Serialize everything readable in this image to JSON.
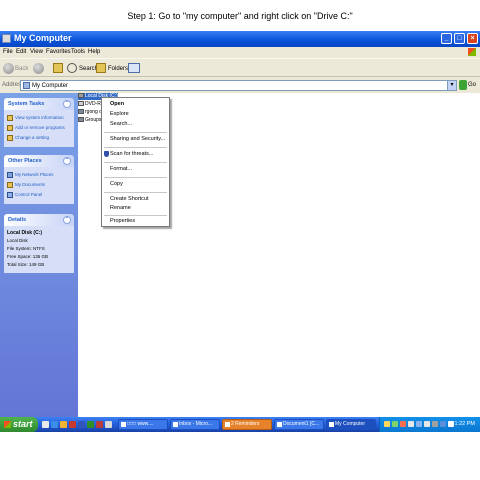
{
  "caption": "Step 1: Go to \"my computer\" and right click on \"Drive C:\"",
  "window": {
    "title": "My Computer",
    "controls": {
      "minimize": "_",
      "maximize": "□",
      "close": "×"
    }
  },
  "menubar": [
    "File",
    "Edit",
    "View",
    "Favorites",
    "Tools",
    "Help"
  ],
  "toolbar": {
    "back": "Back",
    "search": "Search",
    "folders": "Folders"
  },
  "address": {
    "label": "Address",
    "value": "My Computer",
    "go": "Go"
  },
  "sidebar": {
    "system_tasks": {
      "title": "System Tasks",
      "items": [
        "View system information",
        "Add or remove programs",
        "Change a setting"
      ]
    },
    "other_places": {
      "title": "Other Places",
      "items": [
        "My Network Places",
        "My Documents",
        "Control Panel"
      ]
    },
    "details": {
      "title": "Details",
      "name": "Local Disk (C:)",
      "type": "Local Disk",
      "file_system": "File System: NTFS",
      "free_space": "Free Space: 135 GB",
      "total_size": "Total Size: 149 GB"
    }
  },
  "content": {
    "drives": [
      "Local Disk (C:)",
      "DVD-RA",
      "rgong o",
      "Groups"
    ]
  },
  "context_menu": {
    "open": "Open",
    "explore": "Explore",
    "search": "Search...",
    "sharing": "Sharing and Security...",
    "scan": "Scan for threats...",
    "format": "Format...",
    "copy": "Copy",
    "create_shortcut": "Create Shortcut",
    "rename": "Rename",
    "properties": "Properties"
  },
  "taskbar": {
    "start": "start",
    "tasks": [
      "□□□ www....",
      "Inbox - Micro...",
      "2 Reminders",
      "Document1 [C...",
      "My Computer"
    ],
    "clock": "1:22 PM"
  },
  "colors": {
    "titlebar": "#0a52d8",
    "sidebar": "#6f8fe0",
    "selection": "#316ac5",
    "start_button": "#3c9a3a",
    "reminder_task": "#e5822b"
  }
}
